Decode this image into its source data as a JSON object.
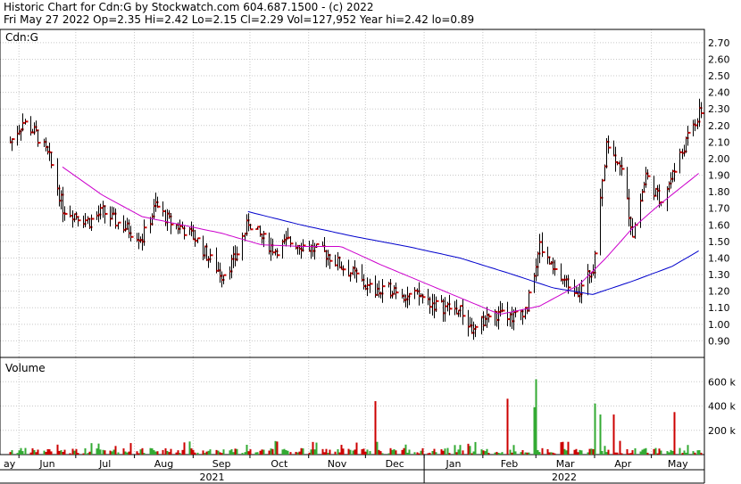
{
  "header": {
    "line1": "Historic Chart for Cdn:G by Stockwatch.com 604.687.1500 - (c) 2022",
    "line2": "Fri May 27 2022  Op=2.35  Hi=2.42  Lo=2.15  Cl=2.29  Vol=127,952  Year hi=2.42  lo=0.89"
  },
  "price_panel": {
    "symbol_label": "Cdn:G"
  },
  "volume_panel": {
    "label": "Volume"
  },
  "colors": {
    "price_bar": "#000000",
    "close_tick": "#cc0000",
    "ma_short": "#cc00cc",
    "ma_long": "#0000cc",
    "vol_up": "#33aa33",
    "vol_down": "#cc0000",
    "grid": "#c8c8c8"
  },
  "chart_data": [
    {
      "type": "line",
      "title": "Cdn:G",
      "price_axis": {
        "ticks": [
          "2.70",
          "2.60",
          "2.50",
          "2.40",
          "2.30",
          "2.20",
          "2.10",
          "2.00",
          "1.90",
          "1.80",
          "1.70",
          "1.60",
          "1.50",
          "1.40",
          "1.30",
          "1.20",
          "1.10",
          "1.00",
          "0.90"
        ],
        "ylim": [
          0.8,
          2.78
        ]
      },
      "x_months": [
        "ay",
        "Jun",
        "Jul",
        "Aug",
        "Sep",
        "Oct",
        "Nov",
        "Dec",
        "Jan",
        "Feb",
        "Mar",
        "Apr",
        "May"
      ],
      "x_years": [
        "2021",
        "2022"
      ],
      "grid": true,
      "price_anchors": [
        {
          "date": "2021-05-27",
          "close": 2.1
        },
        {
          "date": "2021-06-03",
          "close": 2.22
        },
        {
          "date": "2021-06-10",
          "close": 2.15
        },
        {
          "date": "2021-06-17",
          "close": 2.0
        },
        {
          "date": "2021-06-24",
          "close": 1.7
        },
        {
          "date": "2021-07-01",
          "close": 1.66
        },
        {
          "date": "2021-07-08",
          "close": 1.62
        },
        {
          "date": "2021-07-15",
          "close": 1.68
        },
        {
          "date": "2021-07-22",
          "close": 1.62
        },
        {
          "date": "2021-07-29",
          "close": 1.57
        },
        {
          "date": "2021-08-05",
          "close": 1.52
        },
        {
          "date": "2021-08-12",
          "close": 1.72
        },
        {
          "date": "2021-08-19",
          "close": 1.62
        },
        {
          "date": "2021-08-26",
          "close": 1.58
        },
        {
          "date": "2021-09-02",
          "close": 1.52
        },
        {
          "date": "2021-09-09",
          "close": 1.4
        },
        {
          "date": "2021-09-16",
          "close": 1.3
        },
        {
          "date": "2021-09-23",
          "close": 1.4
        },
        {
          "date": "2021-09-30",
          "close": 1.62
        },
        {
          "date": "2021-10-07",
          "close": 1.52
        },
        {
          "date": "2021-10-14",
          "close": 1.45
        },
        {
          "date": "2021-10-21",
          "close": 1.5
        },
        {
          "date": "2021-10-28",
          "close": 1.48
        },
        {
          "date": "2021-11-04",
          "close": 1.45
        },
        {
          "date": "2021-11-11",
          "close": 1.42
        },
        {
          "date": "2021-11-18",
          "close": 1.35
        },
        {
          "date": "2021-11-25",
          "close": 1.3
        },
        {
          "date": "2021-12-02",
          "close": 1.22
        },
        {
          "date": "2021-12-09",
          "close": 1.19
        },
        {
          "date": "2021-12-16",
          "close": 1.22
        },
        {
          "date": "2021-12-23",
          "close": 1.17
        },
        {
          "date": "2021-12-30",
          "close": 1.17
        },
        {
          "date": "2022-01-06",
          "close": 1.12
        },
        {
          "date": "2022-01-13",
          "close": 1.1
        },
        {
          "date": "2022-01-20",
          "close": 1.08
        },
        {
          "date": "2022-01-27",
          "close": 0.95
        },
        {
          "date": "2022-02-03",
          "close": 1.05
        },
        {
          "date": "2022-02-10",
          "close": 1.05
        },
        {
          "date": "2022-02-17",
          "close": 1.05
        },
        {
          "date": "2022-02-24",
          "close": 1.1
        },
        {
          "date": "2022-03-03",
          "close": 1.48
        },
        {
          "date": "2022-03-10",
          "close": 1.32
        },
        {
          "date": "2022-03-17",
          "close": 1.25
        },
        {
          "date": "2022-03-24",
          "close": 1.2
        },
        {
          "date": "2022-03-31",
          "close": 1.35
        },
        {
          "date": "2022-04-07",
          "close": 2.1
        },
        {
          "date": "2022-04-14",
          "close": 1.98
        },
        {
          "date": "2022-04-21",
          "close": 1.55
        },
        {
          "date": "2022-04-28",
          "close": 1.9
        },
        {
          "date": "2022-05-05",
          "close": 1.75
        },
        {
          "date": "2022-05-12",
          "close": 1.9
        },
        {
          "date": "2022-05-19",
          "close": 2.1
        },
        {
          "date": "2022-05-27",
          "close": 2.29
        }
      ],
      "ma_short_anchors": [
        {
          "date": "2021-06-24",
          "value": 1.95
        },
        {
          "date": "2021-07-15",
          "value": 1.78
        },
        {
          "date": "2021-08-05",
          "value": 1.65
        },
        {
          "date": "2021-08-26",
          "value": 1.6
        },
        {
          "date": "2021-09-16",
          "value": 1.55
        },
        {
          "date": "2021-10-07",
          "value": 1.48
        },
        {
          "date": "2021-10-28",
          "value": 1.47
        },
        {
          "date": "2021-11-18",
          "value": 1.47
        },
        {
          "date": "2021-12-09",
          "value": 1.36
        },
        {
          "date": "2021-12-30",
          "value": 1.26
        },
        {
          "date": "2022-01-20",
          "value": 1.16
        },
        {
          "date": "2022-02-10",
          "value": 1.06
        },
        {
          "date": "2022-03-03",
          "value": 1.11
        },
        {
          "date": "2022-03-24",
          "value": 1.24
        },
        {
          "date": "2022-04-07",
          "value": 1.4
        },
        {
          "date": "2022-04-21",
          "value": 1.58
        },
        {
          "date": "2022-05-05",
          "value": 1.72
        },
        {
          "date": "2022-05-27",
          "value": 1.92
        }
      ],
      "ma_long_anchors": [
        {
          "date": "2021-09-30",
          "value": 1.68
        },
        {
          "date": "2021-10-28",
          "value": 1.6
        },
        {
          "date": "2021-11-25",
          "value": 1.53
        },
        {
          "date": "2021-12-23",
          "value": 1.47
        },
        {
          "date": "2022-01-20",
          "value": 1.4
        },
        {
          "date": "2022-02-17",
          "value": 1.3
        },
        {
          "date": "2022-03-10",
          "value": 1.22
        },
        {
          "date": "2022-03-31",
          "value": 1.18
        },
        {
          "date": "2022-04-21",
          "value": 1.26
        },
        {
          "date": "2022-05-12",
          "value": 1.35
        },
        {
          "date": "2022-05-27",
          "value": 1.45
        }
      ]
    },
    {
      "type": "bar",
      "title": "Volume",
      "volume_axis": {
        "ticks": [
          "600 k",
          "400 k",
          "200 k"
        ],
        "ylim": [
          0,
          800
        ]
      },
      "volume_spikes_k": [
        {
          "date": "2021-12-06",
          "value": 440
        },
        {
          "date": "2022-02-14",
          "value": 460
        },
        {
          "date": "2022-03-01",
          "value": 620
        },
        {
          "date": "2022-02-28",
          "value": 390
        },
        {
          "date": "2022-04-01",
          "value": 420
        },
        {
          "date": "2022-04-04",
          "value": 330
        },
        {
          "date": "2022-04-11",
          "value": 330
        },
        {
          "date": "2022-05-13",
          "value": 350
        }
      ]
    }
  ]
}
